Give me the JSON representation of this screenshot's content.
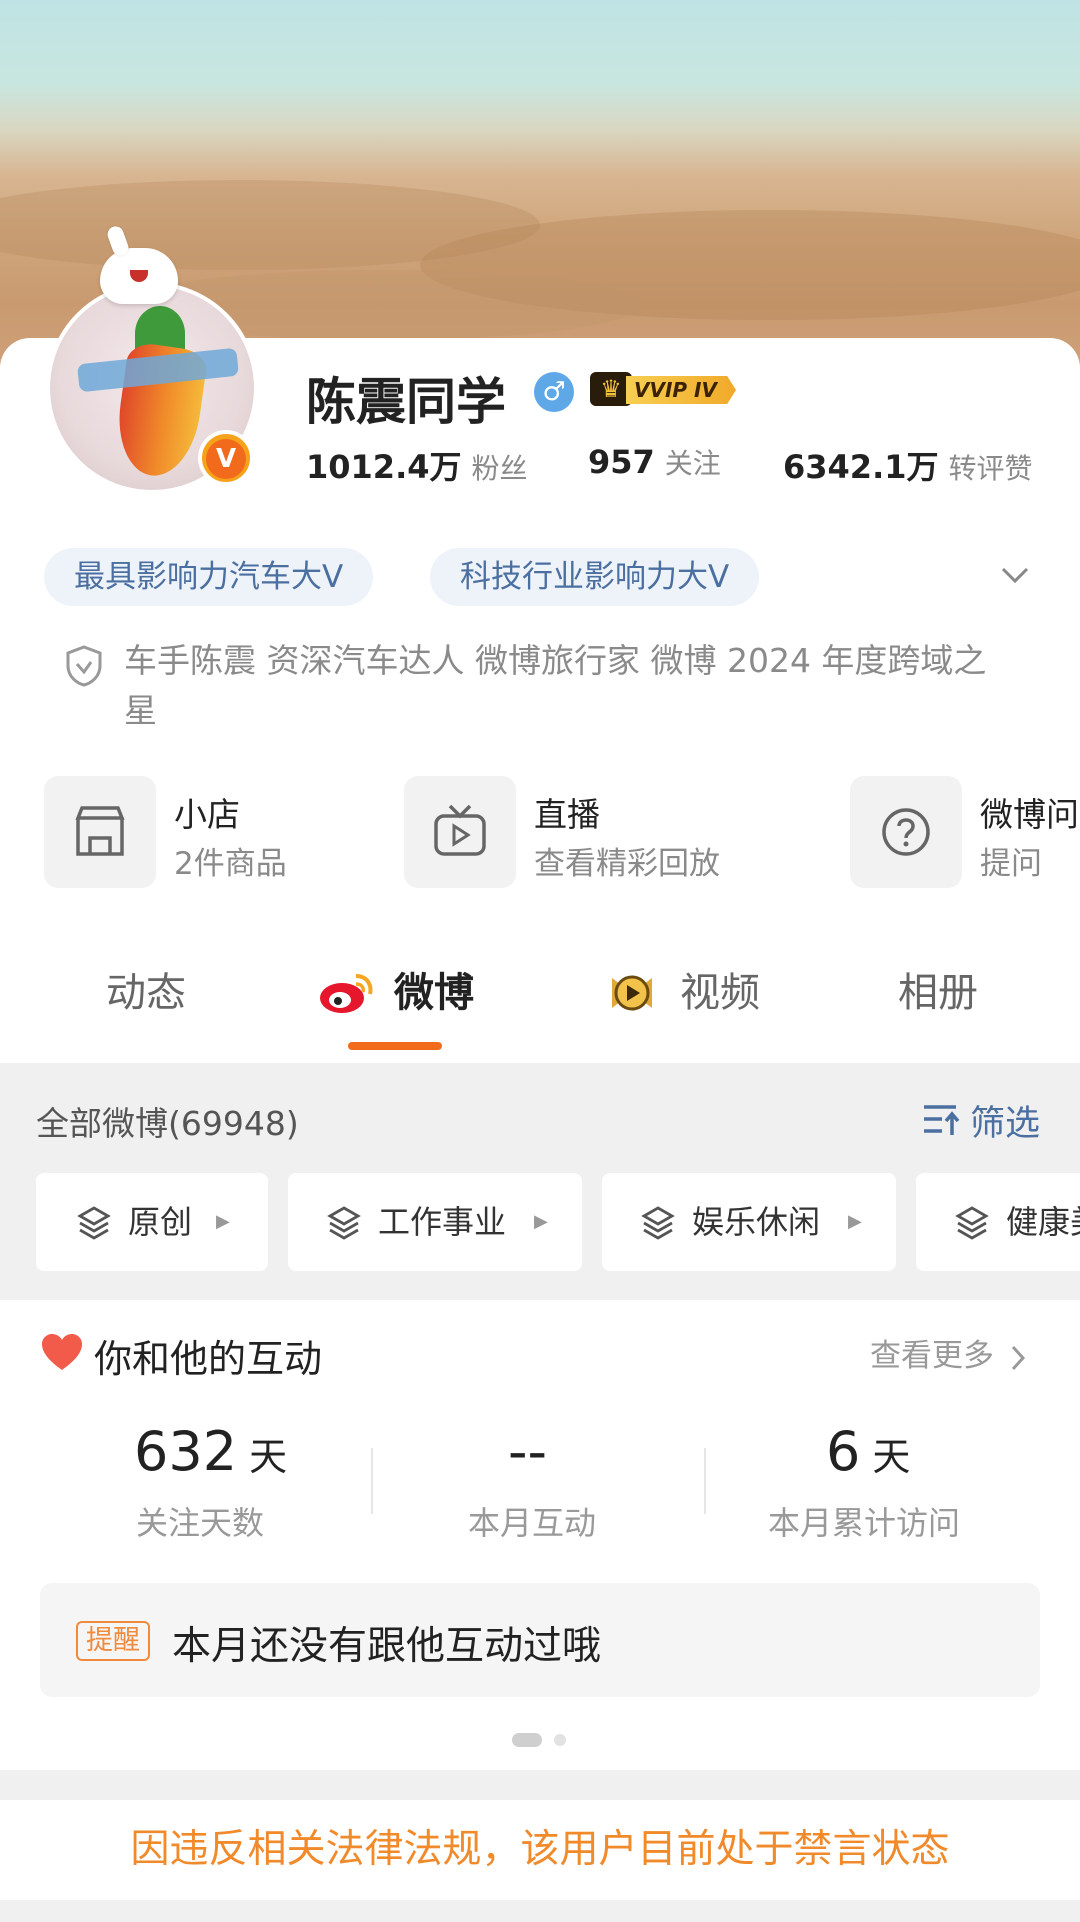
{
  "profile": {
    "name": "陈震同学",
    "gender_symbol": "♂",
    "vip_label": "VVIP IV",
    "verified_mark": "V",
    "stats": [
      {
        "value": "1012.4万",
        "label": "粉丝"
      },
      {
        "value": "957",
        "label": "关注"
      },
      {
        "value": "6342.1万",
        "label": "转评赞"
      }
    ],
    "tags": [
      "最具影响力汽车大V",
      "科技行业影响力大V"
    ],
    "description": "车手陈震 资深汽车达人  微博旅行家 微博 2024 年度跨域之星"
  },
  "services": [
    {
      "title": "小店",
      "subtitle": "2件商品",
      "icon": "store-icon"
    },
    {
      "title": "直播",
      "subtitle": "查看精彩回放",
      "icon": "tv-icon"
    },
    {
      "title": "微博问",
      "subtitle": "提问",
      "icon": "question-icon"
    }
  ],
  "tabs": [
    {
      "label": "动态"
    },
    {
      "label": "微博"
    },
    {
      "label": "视频"
    },
    {
      "label": "相册"
    }
  ],
  "feed": {
    "all_label": "全部微博(69948)",
    "filter_label": "筛选",
    "categories": [
      "原创",
      "工作事业",
      "娱乐休闲",
      "健康美"
    ]
  },
  "interaction": {
    "title": "你和他的互动",
    "more": "查看更多",
    "metrics": [
      {
        "value": "632",
        "unit": "天",
        "label": "关注天数"
      },
      {
        "value": "--",
        "unit": "",
        "label": "本月互动"
      },
      {
        "value": "6",
        "unit": "天",
        "label": "本月累计访问"
      }
    ],
    "reminder_tag": "提醒",
    "reminder_text": "本月还没有跟他互动过哦"
  },
  "ban_notice": "因违反相关法律法规，该用户目前处于禁言状态",
  "colors": {
    "accent": "#f26b1d",
    "link": "#4a6fa0",
    "ban": "#f08a2a"
  }
}
